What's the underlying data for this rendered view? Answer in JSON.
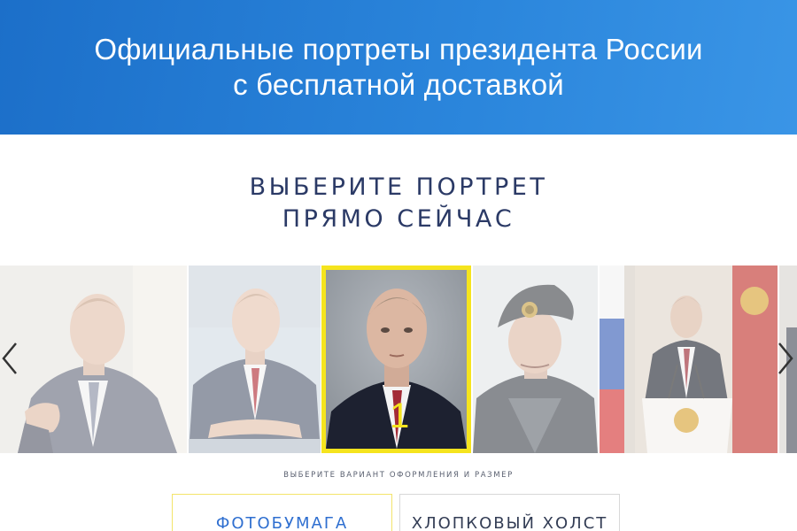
{
  "hero": {
    "line1": "Официальные портреты президента России",
    "line2": "с бесплатной доставкой"
  },
  "section": {
    "line1": "ВЫБЕРИТЕ ПОРТРЕТ",
    "line2": "ПРЯМО СЕЙЧАС"
  },
  "carousel": {
    "selected_number": "1",
    "portraits": [
      {
        "name": "portrait-seated-fist",
        "state": "dimmed"
      },
      {
        "name": "portrait-smiling-desk",
        "state": "dimmed"
      },
      {
        "name": "portrait-official",
        "state": "selected"
      },
      {
        "name": "portrait-navy-cap",
        "state": "dimmed"
      },
      {
        "name": "portrait-podium-flags",
        "state": "dimmed"
      }
    ]
  },
  "options": {
    "subtitle": "ВЫБЕРИТЕ ВАРИАНТ ОФОРМЛЕНИЯ И РАЗМЕР",
    "photo_paper": "ФОТОБУМАГА",
    "canvas": "ХЛОПКОВЫЙ ХОЛСТ"
  },
  "colors": {
    "hero_blue": "#2b86dc",
    "selection_yellow": "#f5e41e",
    "title_navy": "#2b3a66",
    "active_option_text": "#2f6fd0"
  }
}
